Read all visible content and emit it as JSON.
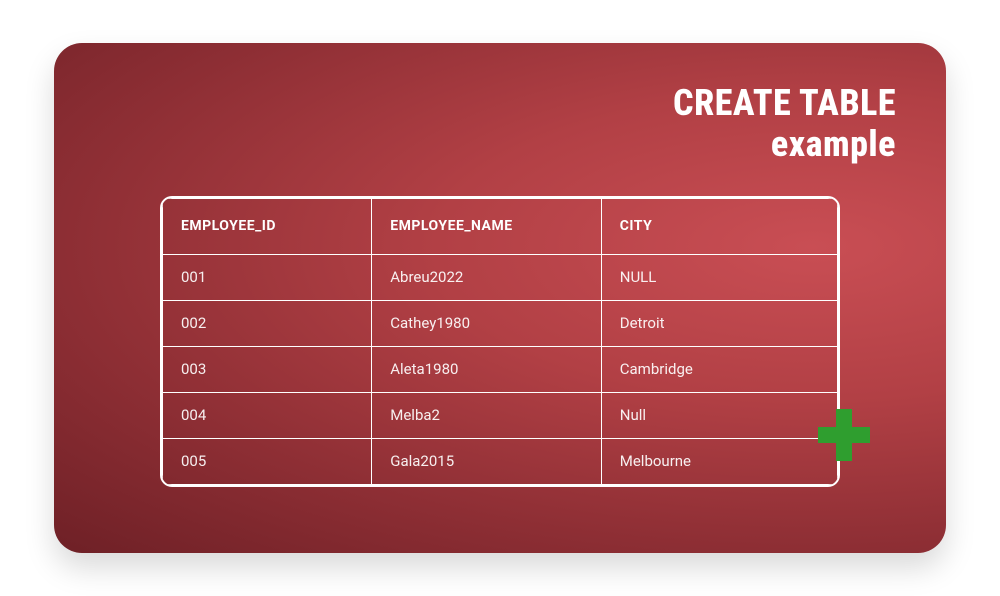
{
  "title_line1": "CREATE TABLE",
  "title_line2": "example",
  "columns": {
    "c0": "EMPLOYEE_ID",
    "c1": "EMPLOYEE_NAME",
    "c2": "CITY"
  },
  "rows": [
    {
      "id": "001",
      "name": "Abreu2022",
      "city": "NULL"
    },
    {
      "id": "002",
      "name": "Cathey1980",
      "city": "Detroit"
    },
    {
      "id": "003",
      "name": "Aleta1980",
      "city": "Cambridge"
    },
    {
      "id": "004",
      "name": "Melba2",
      "city": "Null"
    },
    {
      "id": "005",
      "name": "Gala2015",
      "city": "Melbourne"
    }
  ],
  "icons": {
    "plus": "plus-icon"
  },
  "colors": {
    "accent_green": "#2f9e2f",
    "card_gradient_light": "#c94e54",
    "card_gradient_dark": "#6e2026",
    "border": "#ffffff"
  }
}
